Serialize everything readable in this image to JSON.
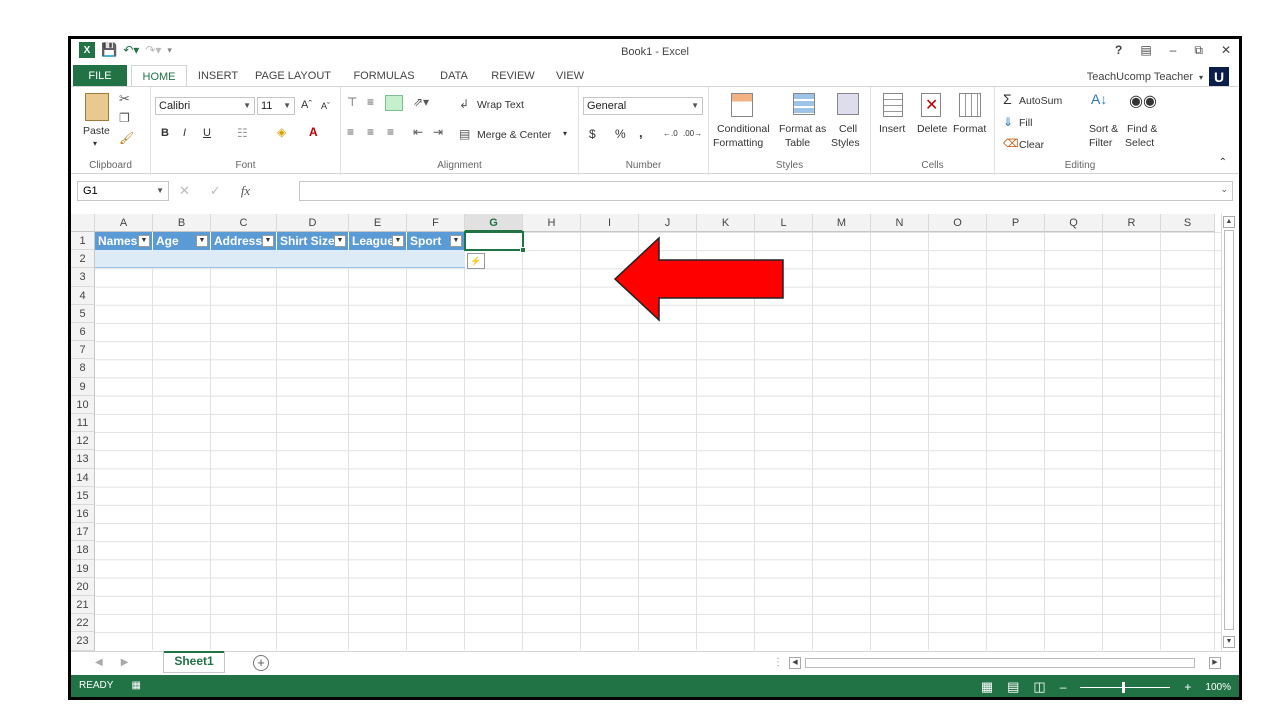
{
  "window": {
    "title": "Book1 - Excel",
    "help": "?",
    "user": "TeachUcomp Teacher",
    "user_badge": "U"
  },
  "tabs": [
    "FILE",
    "HOME",
    "INSERT",
    "PAGE LAYOUT",
    "FORMULAS",
    "DATA",
    "REVIEW",
    "VIEW"
  ],
  "ribbon": {
    "clipboard": {
      "label": "Clipboard",
      "paste": "Paste"
    },
    "font": {
      "label": "Font",
      "name": "Calibri",
      "size": "11",
      "bold": "B",
      "italic": "I",
      "underline": "U"
    },
    "alignment": {
      "label": "Alignment",
      "wrap": "Wrap Text",
      "merge": "Merge & Center"
    },
    "number": {
      "label": "Number",
      "format": "General",
      "currency": "$",
      "percent": "%",
      "comma": ","
    },
    "styles": {
      "label": "Styles",
      "conditional": "Conditional",
      "conditional2": "Formatting",
      "format_as": "Format as",
      "format_as2": "Table",
      "cell": "Cell",
      "cell2": "Styles"
    },
    "cells": {
      "label": "Cells",
      "insert": "Insert",
      "delete": "Delete",
      "format": "Format"
    },
    "editing": {
      "label": "Editing",
      "autosum": "AutoSum",
      "fill": "Fill",
      "clear": "Clear",
      "sort": "Sort &",
      "sort2": "Filter",
      "find": "Find &",
      "find2": "Select"
    }
  },
  "formula_bar": {
    "name_box": "G1",
    "fx": "fx",
    "value": ""
  },
  "columns": [
    "A",
    "B",
    "C",
    "D",
    "E",
    "F",
    "G",
    "H",
    "I",
    "J",
    "K",
    "L",
    "M",
    "N",
    "O",
    "P",
    "Q",
    "R",
    "S"
  ],
  "rows": [
    "1",
    "2",
    "3",
    "4",
    "5",
    "6",
    "7",
    "8",
    "9",
    "10",
    "11",
    "12",
    "13",
    "14",
    "15",
    "16",
    "17",
    "18",
    "19",
    "20",
    "21",
    "22",
    "23"
  ],
  "table_headers": [
    "Names",
    "Age",
    "Address",
    "Shirt Size",
    "League",
    "Sport"
  ],
  "sheets": [
    {
      "name": "Sheet1",
      "active": true
    }
  ],
  "status": {
    "mode": "READY",
    "zoom": "100%"
  },
  "colors": {
    "excel_green": "#217346",
    "table_header": "#5b9bd5",
    "table_row": "#ddebf7",
    "arrow": "#ff0000"
  }
}
